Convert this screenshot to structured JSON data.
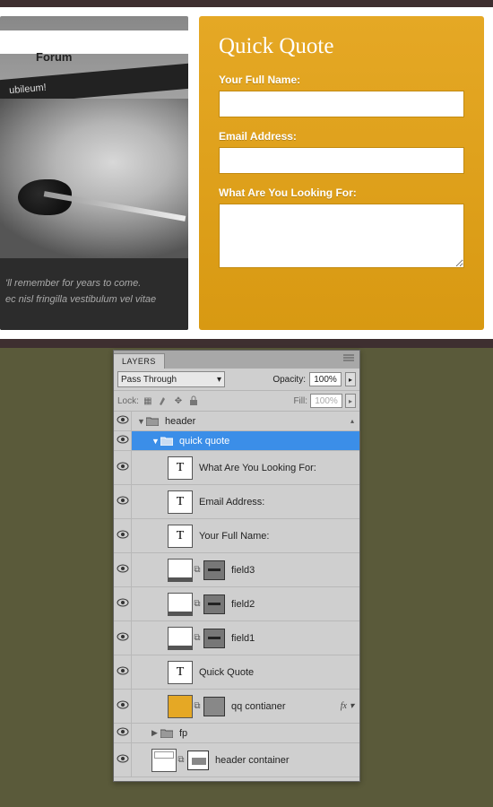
{
  "preview": {
    "nav_item": "Forum",
    "banner_text": "ubileum!",
    "caption_line1": "'ll remember for years to come.",
    "caption_line2": "ec nisl fringilla vestibulum vel vitae"
  },
  "quote": {
    "title": "Quick Quote",
    "name_label": "Your Full Name:",
    "email_label": "Email Address:",
    "looking_label": "What Are You Looking For:"
  },
  "layers_panel": {
    "tab": "LAYERS",
    "blend_mode": "Pass Through",
    "opacity_label": "Opacity:",
    "opacity_value": "100%",
    "lock_label": "Lock:",
    "fill_label": "Fill:",
    "fill_value": "100%",
    "fx_label": "fx",
    "layers": [
      {
        "name": "header",
        "type": "folder",
        "expanded": true,
        "depth": 1
      },
      {
        "name": "quick quote",
        "type": "folder",
        "expanded": true,
        "depth": 2,
        "selected": true
      },
      {
        "name": "What Are You Looking For:",
        "type": "text",
        "depth": 3
      },
      {
        "name": "Email Address:",
        "type": "text",
        "depth": 3
      },
      {
        "name": "Your Full Name:",
        "type": "text",
        "depth": 3
      },
      {
        "name": "field3",
        "type": "shape-mask",
        "depth": 3
      },
      {
        "name": "field2",
        "type": "shape-mask",
        "depth": 3
      },
      {
        "name": "field1",
        "type": "shape-mask",
        "depth": 3
      },
      {
        "name": "Quick Quote",
        "type": "text",
        "depth": 3
      },
      {
        "name": "qq contianer",
        "type": "yellow-mask",
        "depth": 3,
        "fx": true
      },
      {
        "name": "fp",
        "type": "folder",
        "expanded": false,
        "depth": 2
      },
      {
        "name": "header container",
        "type": "header-mask",
        "depth": 2
      }
    ]
  }
}
